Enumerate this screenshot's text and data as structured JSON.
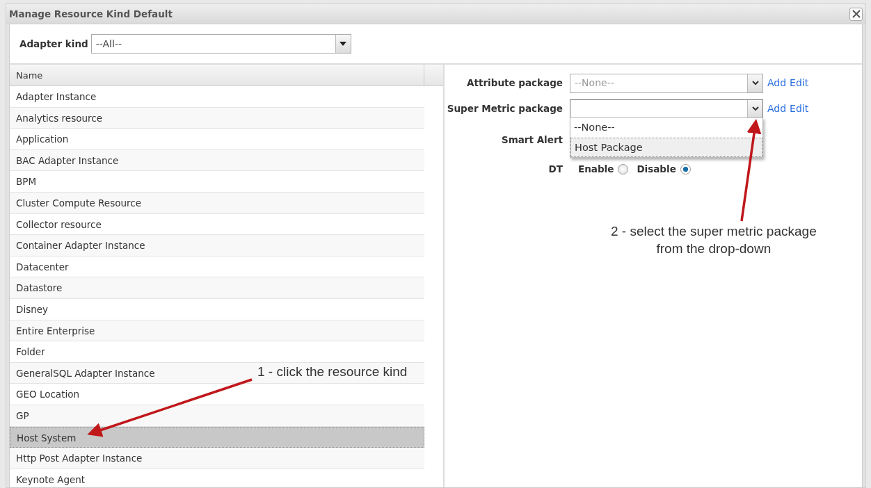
{
  "window": {
    "title": "Manage Resource Kind Default"
  },
  "filter": {
    "label": "Adapter kind",
    "value": "--All--"
  },
  "table": {
    "columns": [
      "Name"
    ],
    "rows": [
      {
        "name": "Adapter Instance",
        "selected": false
      },
      {
        "name": "Analytics resource",
        "selected": false
      },
      {
        "name": "Application",
        "selected": false
      },
      {
        "name": "BAC Adapter Instance",
        "selected": false
      },
      {
        "name": "BPM",
        "selected": false
      },
      {
        "name": "Cluster Compute Resource",
        "selected": false
      },
      {
        "name": "Collector resource",
        "selected": false
      },
      {
        "name": "Container Adapter Instance",
        "selected": false
      },
      {
        "name": "Datacenter",
        "selected": false
      },
      {
        "name": "Datastore",
        "selected": false
      },
      {
        "name": "Disney",
        "selected": false
      },
      {
        "name": "Entire Enterprise",
        "selected": false
      },
      {
        "name": "Folder",
        "selected": false
      },
      {
        "name": "GeneralSQL Adapter Instance",
        "selected": false
      },
      {
        "name": "GEO Location",
        "selected": false
      },
      {
        "name": "GP",
        "selected": false
      },
      {
        "name": "Host System",
        "selected": true
      },
      {
        "name": "Http Post Adapter Instance",
        "selected": false
      },
      {
        "name": "Keynote Agent",
        "selected": false
      }
    ]
  },
  "settings": [
    {
      "kind": "select",
      "label": "Attribute package",
      "value": "--None--",
      "links": [
        "Add",
        "Edit"
      ]
    },
    {
      "kind": "select",
      "label": "Super Metric package",
      "links": [
        "Add",
        "Edit"
      ],
      "expanded": true,
      "options": [
        {
          "label": "--None--",
          "selected": false
        },
        {
          "label": "Host Package",
          "selected": true
        }
      ]
    },
    {
      "kind": "hidden",
      "label": "Smart Alert"
    },
    {
      "kind": "radio",
      "label": "DT",
      "choices": [
        {
          "label": "Enable",
          "checked": false
        },
        {
          "label": "Disable",
          "checked": true
        }
      ]
    }
  ],
  "annotations": [
    {
      "lines": [
        "1 - click the resource kind"
      ]
    },
    {
      "lines": [
        "2 - select the super metric package",
        "from the drop-down"
      ]
    }
  ]
}
